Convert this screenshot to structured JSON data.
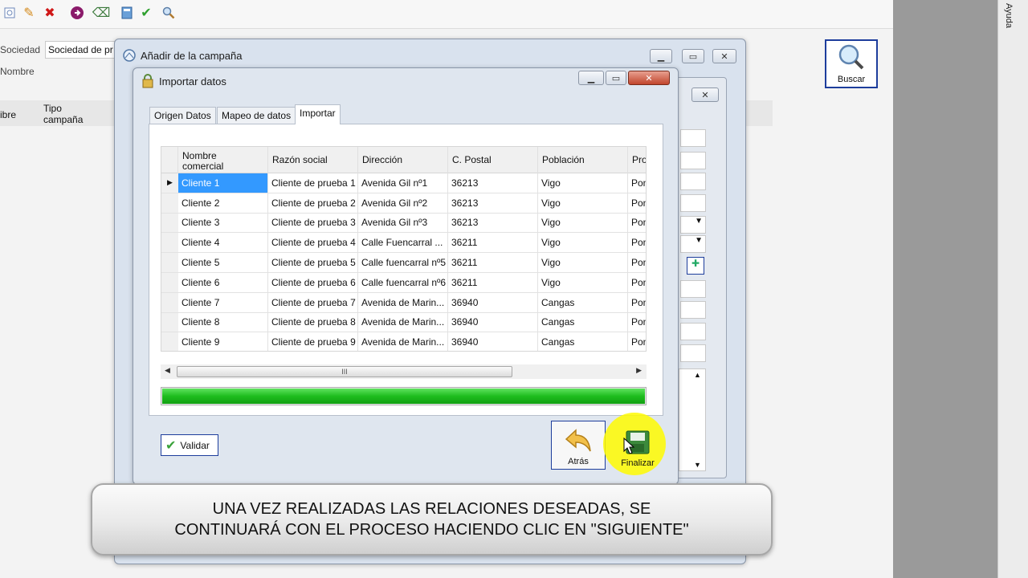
{
  "background": {
    "sociedad_label": "Sociedad",
    "sociedad_value": "Sociedad de pr",
    "nombre_label": "Nombre",
    "col_nombre": "ibre",
    "col_tipo_line1": "Tipo",
    "col_tipo_line2": "campaña",
    "buscar_label": "Buscar",
    "ayuda_label": "Ayuda"
  },
  "window_campana": {
    "title": "Añadir de la campaña"
  },
  "window_importar": {
    "title": "Importar datos",
    "tabs": [
      "Origen Datos",
      "Mapeo de datos",
      "Importar"
    ],
    "active_tab": "Importar"
  },
  "grid": {
    "columns": [
      "Nombre comercial",
      "Razón social",
      "Dirección",
      "C. Postal",
      "Población",
      "Pro"
    ],
    "rows": [
      [
        "Cliente 1",
        "Cliente de prueba 1",
        "Avenida Gil nº1",
        "36213",
        "Vigo",
        "Pon"
      ],
      [
        "Cliente 2",
        "Cliente de prueba 2",
        "Avenida Gil nº2",
        "36213",
        "Vigo",
        "Pon"
      ],
      [
        "Cliente 3",
        "Cliente de prueba 3",
        "Avenida Gil nº3",
        "36213",
        "Vigo",
        "Pon"
      ],
      [
        "Cliente 4",
        "Cliente de prueba 4",
        "Calle Fuencarral ...",
        "36211",
        "Vigo",
        "Pon"
      ],
      [
        "Cliente 5",
        "Cliente de prueba 5",
        "Calle fuencarral nº5",
        "36211",
        "Vigo",
        "Pon"
      ],
      [
        "Cliente 6",
        "Cliente de prueba 6",
        "Calle fuencarral nº6",
        "36211",
        "Vigo",
        "Pon"
      ],
      [
        "Cliente 7",
        "Cliente de prueba 7",
        "Avenida de Marin...",
        "36940",
        "Cangas",
        "Pon"
      ],
      [
        "Cliente 8",
        "Cliente de prueba 8",
        "Avenida de Marin...",
        "36940",
        "Cangas",
        "Pon"
      ],
      [
        "Cliente 9",
        "Cliente de prueba 9",
        "Avenida de Marin...",
        "36940",
        "Cangas",
        "Pon"
      ]
    ],
    "selected_row": 0,
    "scroll_thumb": "III"
  },
  "progress": {
    "value": 100
  },
  "buttons": {
    "validar": "Validar",
    "atras": "Atrás",
    "finalizar": "Finalizar"
  },
  "subtitle": {
    "line1": "UNA VEZ REALIZADAS LAS RELACIONES DESEADAS, SE",
    "line2": "CONTINUARÁ CON EL PROCESO HACIENDO CLIC EN \"SIGUIENTE\""
  },
  "colors": {
    "selection": "#3399ff",
    "progress_green": "#1ebd1e",
    "button_border": "#1d3d9c",
    "highlight_yellow": "#fffa00"
  }
}
